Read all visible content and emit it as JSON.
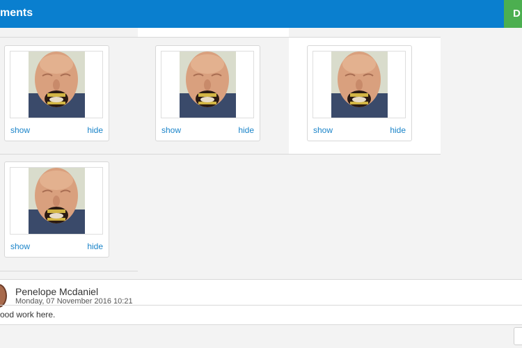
{
  "header": {
    "title": "ments",
    "right_button_label": "D"
  },
  "gallery": {
    "cards": [
      {
        "show_label": "show",
        "hide_label": "hide"
      },
      {
        "show_label": "show",
        "hide_label": "hide"
      },
      {
        "show_label": "show",
        "hide_label": "hide"
      },
      {
        "show_label": "show",
        "hide_label": "hide"
      }
    ]
  },
  "comment": {
    "author": "Penelope Mcdaniel",
    "timestamp": "Monday, 07 November 2016 10:21",
    "text": "ood work here."
  }
}
